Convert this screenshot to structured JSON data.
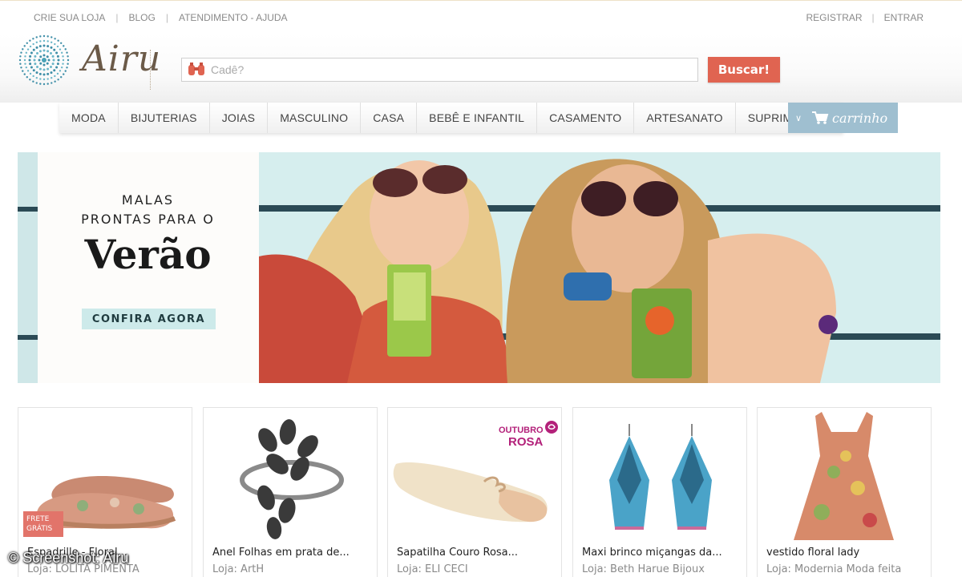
{
  "top_links": {
    "crie_sua_loja": "CRIE SUA LOJA",
    "blog": "BLOG",
    "atendimento": "ATENDIMENTO - AJUDA",
    "registrar": "REGISTRAR",
    "entrar": "ENTRAR"
  },
  "logo": {
    "text": "Airu"
  },
  "search": {
    "placeholder": "Cadê?",
    "button": "Buscar!"
  },
  "nav": {
    "items": [
      "MODA",
      "BIJUTERIAS",
      "JOIAS",
      "MASCULINO",
      "CASA",
      "BEBÊ E INFANTIL",
      "CASAMENTO",
      "ARTESANATO",
      "SUPRIMENTOS"
    ],
    "cart": "carrinho"
  },
  "hero": {
    "line1": "MALAS",
    "line2": "PRONTAS PARA O",
    "big": "Verão",
    "cta": "CONFIRA AGORA"
  },
  "products": [
    {
      "name": "Espadrille - Floral...",
      "store": "Loja: LOLITA PIMENTA",
      "badge": "FRETE GRÁTIS"
    },
    {
      "name": "Anel Folhas em prata de...",
      "store": "Loja: ArtH"
    },
    {
      "name": "Sapatilha Couro Rosa...",
      "store": "Loja: ELI CECI",
      "badge_line1": "OUTUBRO",
      "badge_line2": "ROSA"
    },
    {
      "name": "Maxi brinco miçangas da...",
      "store": "Loja: Beth Harue Bijoux"
    },
    {
      "name": "vestido floral lady",
      "store": "Loja: Modernia Moda feita"
    }
  ],
  "watermark": "© Screenshot: Airu",
  "colors": {
    "accent_red": "#e06451",
    "cart_blue": "#9fbfd0",
    "cta_teal": "#cdeaea",
    "logo_brown": "#6b5a48",
    "rosa": "#b3217a"
  }
}
